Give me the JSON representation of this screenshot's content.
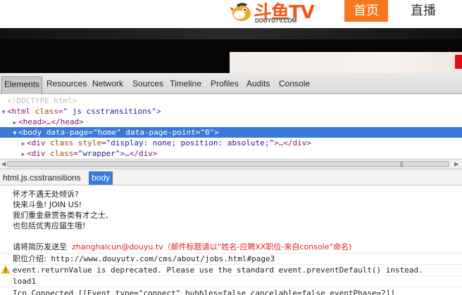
{
  "site": {
    "logo_text": "斗鱼TV",
    "logo_sub": "DOUYUTV.COM",
    "nav": {
      "home": "首页",
      "live": "直播"
    }
  },
  "devtools": {
    "tabs": [
      "Elements",
      "Resources",
      "Network",
      "Sources",
      "Timeline",
      "Profiles",
      "Audits",
      "Console"
    ],
    "active_tab": "Elements",
    "dom": {
      "doctype": "<!DOCTYPE html>",
      "html_open": "<html",
      "html_attr_name": "class",
      "html_attr_value": "\" js csstransitions\"",
      "head": "<head>…</head>",
      "body_open": "<body",
      "body_attr1_name": "data-page",
      "body_attr1_value": "\"home\"",
      "body_attr2_name": "data-page-point",
      "body_attr2_value": "\"0\"",
      "div1_attr_name": "class style",
      "div1_attr_value": "\"display: none; position: absolute;\"",
      "div1_tail": ">…</div>",
      "div2_attr_name": "class",
      "div2_attr_value": "\"wrapper\"",
      "div2_tail": ">…</div>"
    },
    "breadcrumbs": [
      "html.js.csstransitions",
      "body"
    ],
    "console": {
      "lines": [
        "怀才不遇无处倾诉?",
        "快来斗鱼! JOIN US!",
        "我们重金悬赏各类有才之士,",
        "也包括优秀应届生哦!"
      ],
      "apply_prefix": "请将简历发送至",
      "apply_email": "zhanghaicun@douyu.tv（邮件标题请以“姓名-应聘XX职位-来自console”命名)",
      "job_prefix": "职位介绍:",
      "job_url": "http://www.douyutv.com/cms/about/jobs.html#page3",
      "warning": "event.returnValue is deprecated. Please use the standard event.preventDefault() instead.",
      "load": "load1",
      "connected": "Icp Connected [[Event type=\"connect\" bubbles=false cancelable=false eventPhase=2]]"
    }
  },
  "colors": {
    "brand_orange": "#f5781f",
    "selection_blue": "#3879d9",
    "highlight_red": "#e02020"
  }
}
